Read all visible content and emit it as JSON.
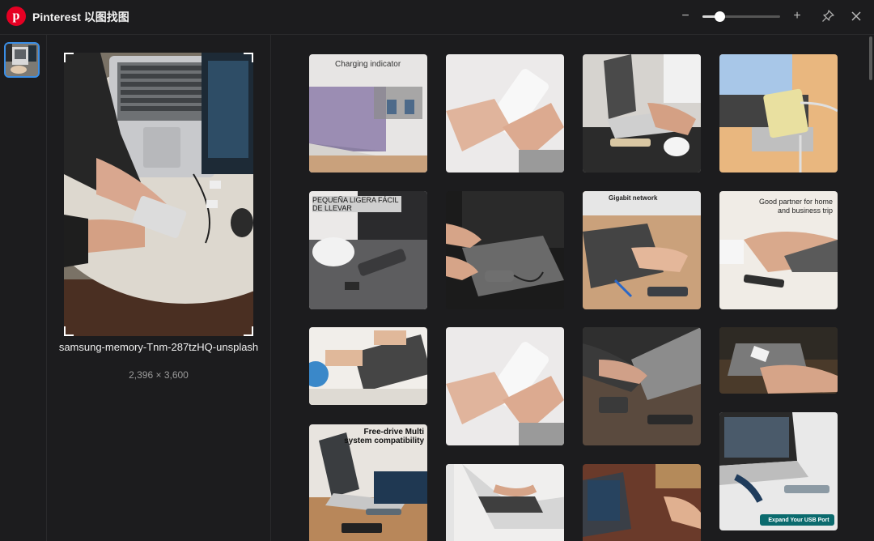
{
  "app": {
    "title": "Pinterest 以图找图",
    "logo_letter": "p"
  },
  "controls": {
    "zoom_minus": "−",
    "zoom_plus": "+",
    "zoom_level": 0.18
  },
  "preview": {
    "file_name": "samsung-memory-Tnm-287tzHQ-unsplash",
    "dimensions": "2,396 × 3,600"
  },
  "tile_text": {
    "t1_title": "Charging indicator",
    "t5_title": "PEQUEÑA LIGERA FÁCIL DE LLEVAR",
    "t7_title": "Gigabit network",
    "t8_title": "Good partner for home and business trip",
    "t13_title": "Free-drive Multi system compatibility",
    "t16_title": "Expand Your USB Port"
  }
}
